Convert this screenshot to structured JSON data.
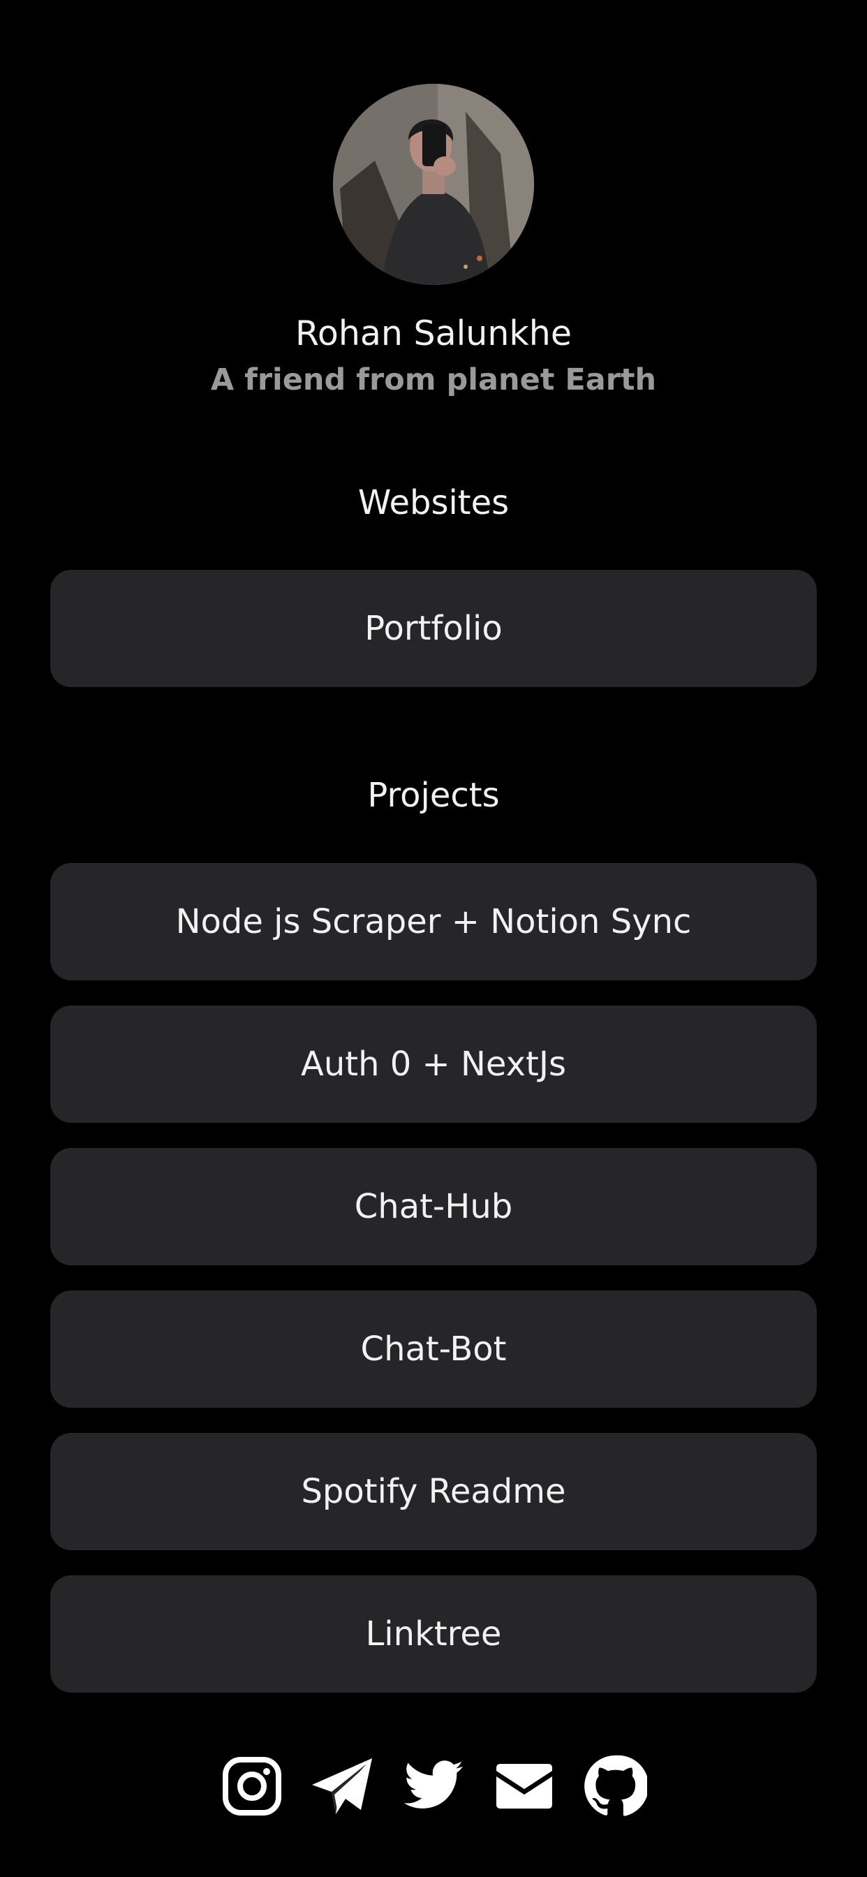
{
  "profile": {
    "name": "Rohan Salunkhe",
    "tagline": "A friend from planet Earth",
    "avatar": "profile-photo"
  },
  "sections": {
    "websites": {
      "title": "Websites",
      "links": [
        {
          "label": "Portfolio"
        }
      ]
    },
    "projects": {
      "title": "Projects",
      "links": [
        {
          "label": "Node js Scraper + Notion Sync"
        },
        {
          "label": "Auth 0 + NextJs"
        },
        {
          "label": "Chat-Hub"
        },
        {
          "label": "Chat-Bot"
        },
        {
          "label": "Spotify Readme"
        },
        {
          "label": "Linktree"
        }
      ]
    }
  },
  "socials": [
    {
      "icon": "instagram-icon"
    },
    {
      "icon": "telegram-icon"
    },
    {
      "icon": "twitter-icon"
    },
    {
      "icon": "mail-icon"
    },
    {
      "icon": "github-icon"
    }
  ],
  "colors": {
    "background": "#000000",
    "button": "#262628",
    "text": "#f2f2f2",
    "tagline": "#9a9a9a"
  }
}
